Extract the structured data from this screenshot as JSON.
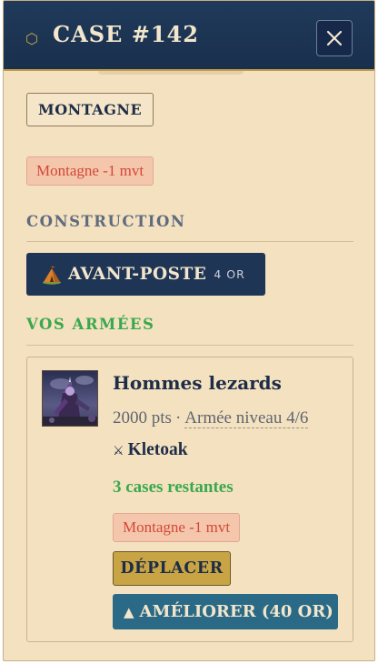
{
  "header": {
    "icon": "hexagon-icon",
    "title": "CASE #142",
    "close_icon": "close-icon"
  },
  "tile": {
    "terrain": "MONTAGNE",
    "malus": "Montagne -1 mvt"
  },
  "construction": {
    "section_title": "CONSTRUCTION",
    "build_button": {
      "icon": "tent-icon",
      "label": "AVANT-POSTE",
      "cost": "4 OR"
    }
  },
  "armies": {
    "section_title": "VOS ARMÉES",
    "items": [
      {
        "portrait": "army-portrait",
        "name": "Hommes lezards",
        "points": "2000 pts",
        "separator": "·",
        "level": "Armée niveau 4/6",
        "leader_icon": "crossed-swords-icon",
        "leader": "Kletoak",
        "moves_left": "3 cases restantes",
        "malus": "Montagne -1 mvt",
        "move_button": "DÉPLACER",
        "upgrade_button": "AMÉLIORER (40 OR)",
        "upgrade_icon": "triangle-up-icon"
      }
    ]
  },
  "colors": {
    "panel_bg": "#f4e1c0",
    "header_bg": "#1f3556",
    "gold": "#c8a444",
    "malus_bg": "#f4c7ad",
    "malus_text": "#d34736",
    "green": "#3aa84e",
    "upgrade_bg": "#2a6a86"
  }
}
